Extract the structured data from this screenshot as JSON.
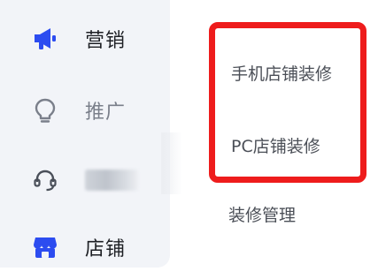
{
  "sidebar": {
    "items": [
      {
        "label": "营销",
        "icon": "megaphone-icon",
        "active": true
      },
      {
        "label": "推广",
        "icon": "lightbulb-icon"
      },
      {
        "label": "",
        "icon": "headset-icon",
        "label_obscured": true
      },
      {
        "label": "店铺",
        "icon": "storefront-icon"
      }
    ]
  },
  "store_menu": {
    "items": [
      {
        "label": "手机店铺装修"
      },
      {
        "label": "PC店铺装修"
      }
    ],
    "extra_item": {
      "label": "装修管理"
    }
  },
  "colors": {
    "accent_blue": "#2c4cf0",
    "highlight_border": "#ee1c1c",
    "sidebar_bg": "#f2f4f8",
    "muted_icon": "#7a7f8a"
  }
}
